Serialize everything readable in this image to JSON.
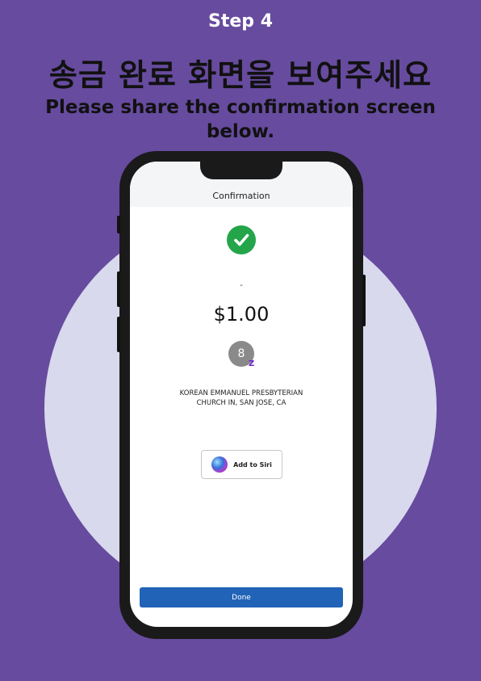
{
  "header": {
    "step": "Step 4",
    "title_ko": "송금 완료 화면을 보여주세요",
    "title_en": "Please share the confirmation screen below."
  },
  "colors": {
    "background": "#674b9f",
    "circle": "#d8d9ec",
    "success_green": "#24a54a",
    "done_blue": "#2163b7",
    "zelle_purple": "#6d1ed4"
  },
  "phone": {
    "screen_title": "Confirmation",
    "success_icon": "checkmark-icon",
    "dash": "-",
    "amount": "$1.00",
    "avatar_initial": "8",
    "zelle_glyph": "Z",
    "recipient_line1": "KOREAN EMMANUEL PRESBYTERIAN",
    "recipient_line2": "CHURCH IN, SAN JOSE, CA",
    "siri_label": "Add to Siri",
    "done_label": "Done"
  }
}
